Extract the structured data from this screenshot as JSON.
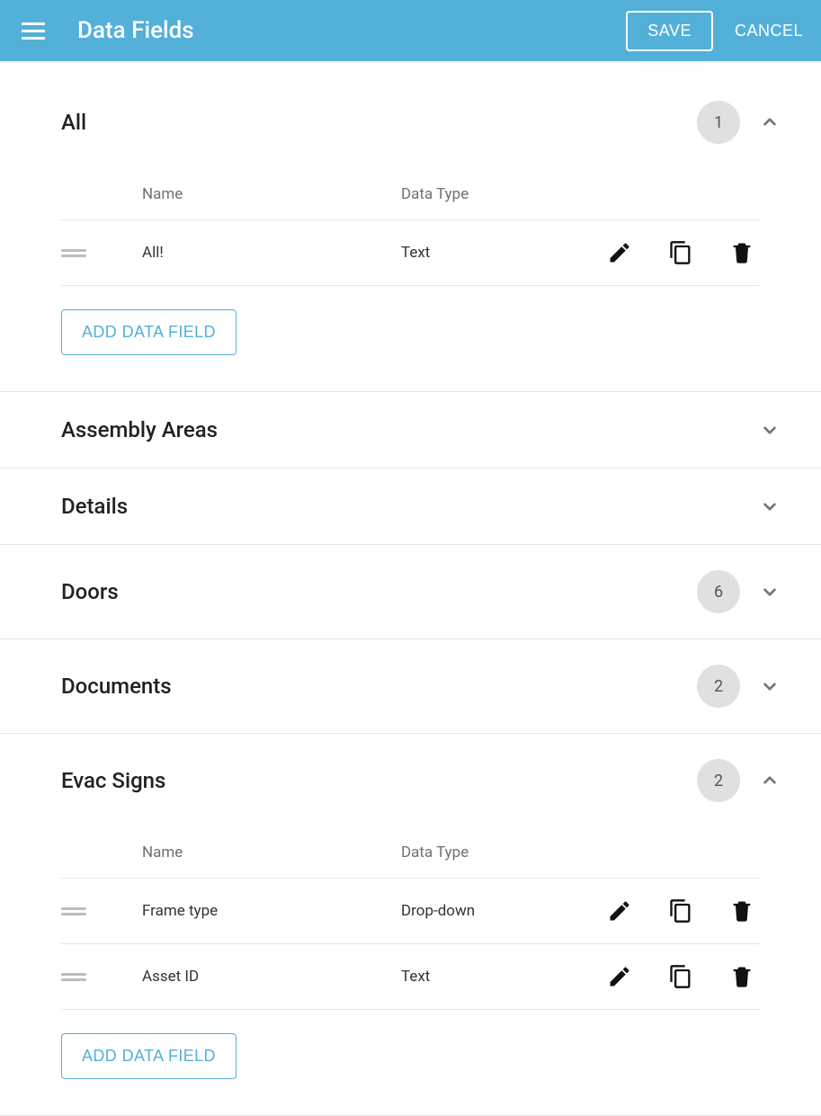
{
  "header": {
    "title": "Data Fields",
    "save_label": "SAVE",
    "cancel_label": "CANCEL"
  },
  "column_headers": {
    "name": "Name",
    "type": "Data Type"
  },
  "add_button_label": "ADD DATA FIELD",
  "sections": [
    {
      "title": "All",
      "count": "1",
      "expanded": true,
      "rows": [
        {
          "name": "All!",
          "type": "Text"
        }
      ]
    },
    {
      "title": "Assembly Areas",
      "count": null,
      "expanded": false,
      "rows": []
    },
    {
      "title": "Details",
      "count": null,
      "expanded": false,
      "rows": []
    },
    {
      "title": "Doors",
      "count": "6",
      "expanded": false,
      "rows": []
    },
    {
      "title": "Documents",
      "count": "2",
      "expanded": false,
      "rows": []
    },
    {
      "title": "Evac Signs",
      "count": "2",
      "expanded": true,
      "rows": [
        {
          "name": "Frame type",
          "type": "Drop-down"
        },
        {
          "name": "Asset ID",
          "type": "Text"
        }
      ]
    }
  ]
}
